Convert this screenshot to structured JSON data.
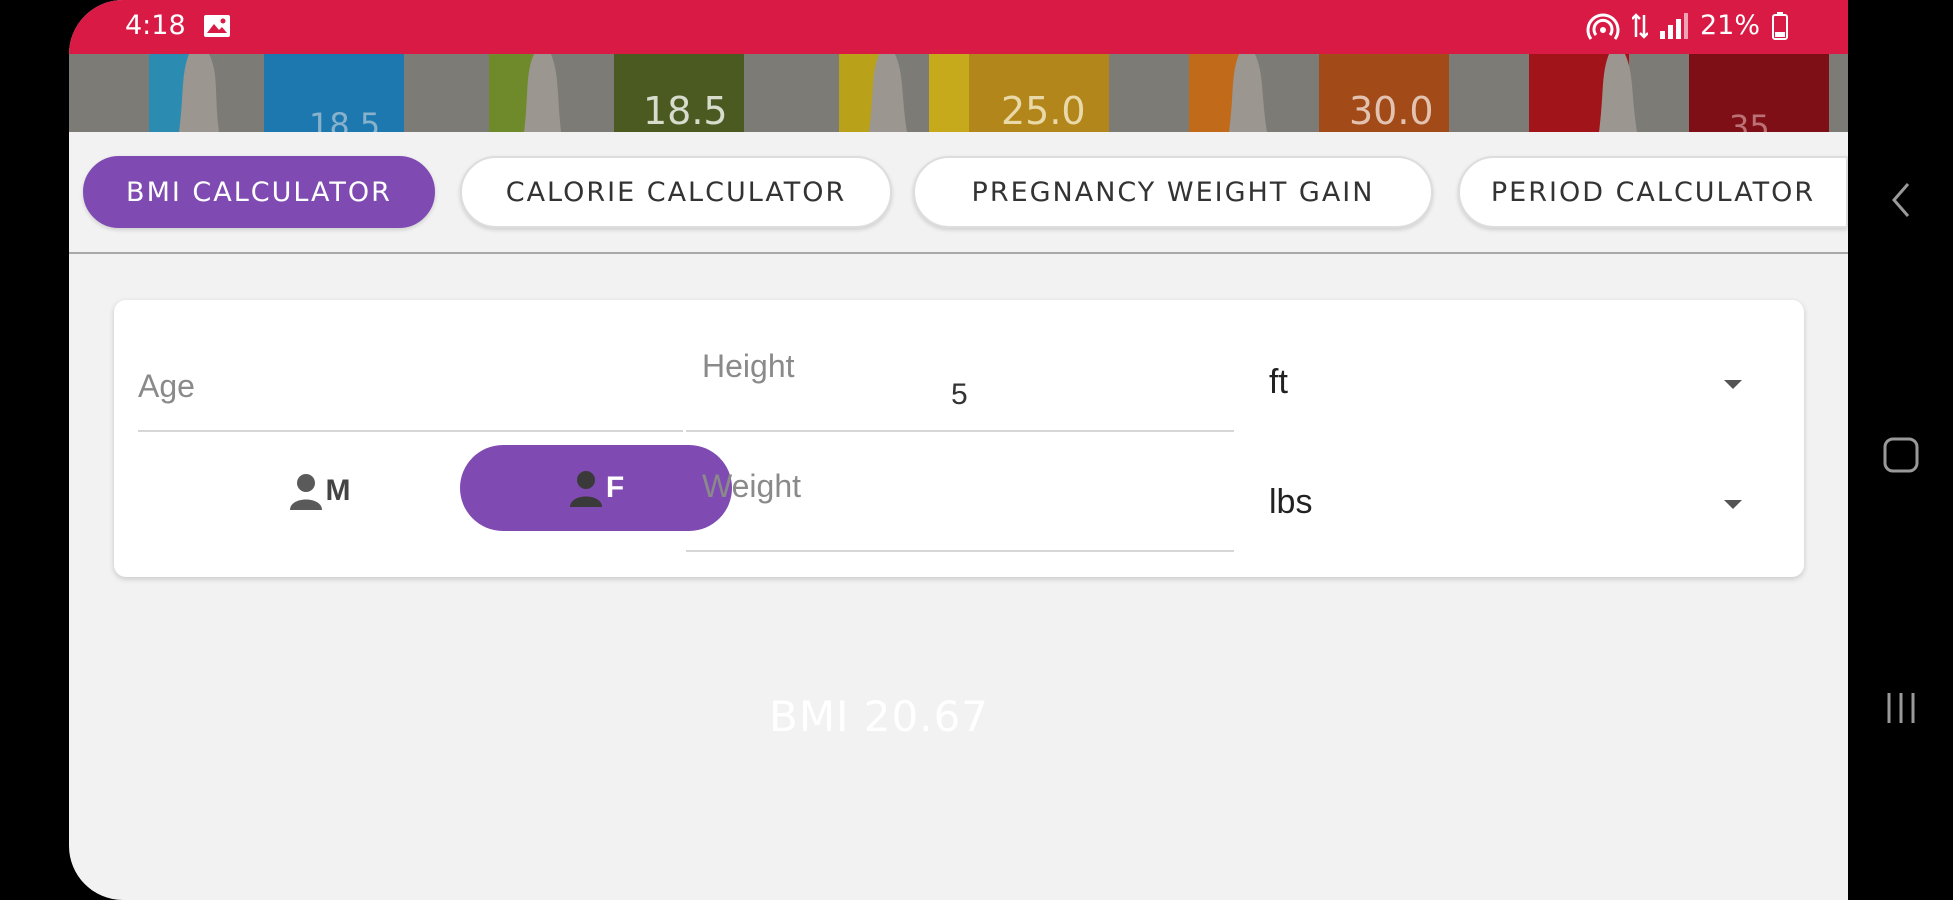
{
  "status_bar": {
    "time": "4:18",
    "battery": "21%",
    "icons": [
      "gallery-icon",
      "hotspot-icon",
      "data-arrows-icon",
      "signal-icon",
      "battery-icon"
    ]
  },
  "banner": {
    "labels": [
      "18.5",
      "18.5",
      "25.0",
      "30.0",
      "35"
    ]
  },
  "tabs": [
    {
      "label": "BMI CALCULATOR",
      "active": true
    },
    {
      "label": "CALORIE CALCULATOR",
      "active": false
    },
    {
      "label": "PREGNANCY WEIGHT GAIN",
      "active": false
    },
    {
      "label": "PERIOD CALCULATOR",
      "active": false
    }
  ],
  "form": {
    "age": {
      "label": "Age",
      "value": ""
    },
    "height": {
      "label": "Height",
      "value": "5",
      "unit": "ft"
    },
    "weight": {
      "label": "Weight",
      "value": "",
      "unit": "lbs"
    },
    "gender": {
      "male": "M",
      "female": "F",
      "selected": "F"
    }
  },
  "result": {
    "bmi_text": "BMI 20.67"
  },
  "colors": {
    "status_bar": "#d81a45",
    "accent": "#7f4bb2",
    "background": "#f2f2f2"
  }
}
